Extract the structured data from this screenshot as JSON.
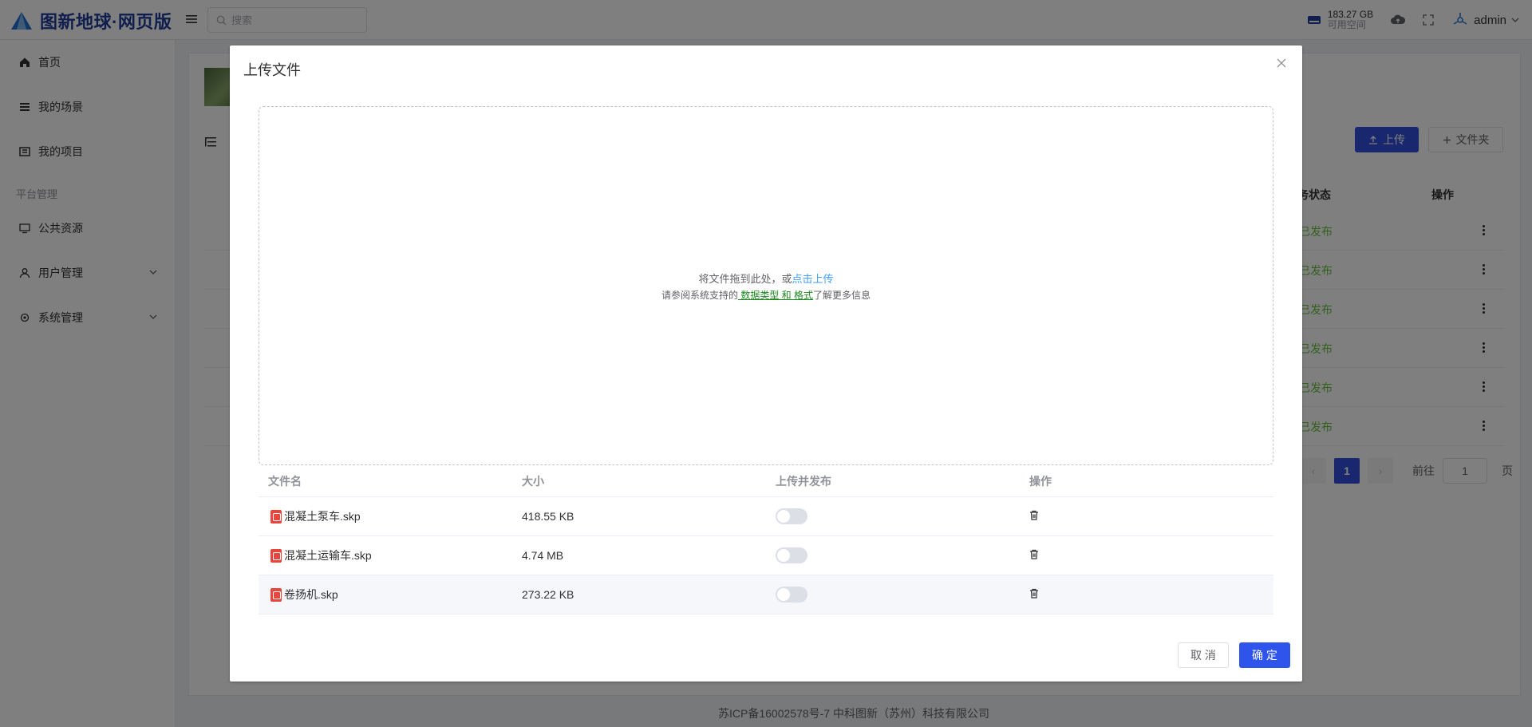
{
  "app": {
    "title": "图新地球·网页版",
    "search_placeholder": "搜索",
    "storage_size": "183.27 GB",
    "storage_label": "可用空间",
    "user": "admin",
    "accent": "#3350dd"
  },
  "sidebar": {
    "items": [
      {
        "label": "首页",
        "icon": "home-icon"
      },
      {
        "label": "我的场景",
        "icon": "list-icon"
      },
      {
        "label": "我的项目",
        "icon": "project-icon"
      }
    ],
    "group_label": "平台管理",
    "group_items": [
      {
        "label": "公共资源",
        "icon": "monitor-icon"
      },
      {
        "label": "用户管理",
        "icon": "user-icon"
      },
      {
        "label": "系统管理",
        "icon": "settings-icon"
      }
    ]
  },
  "main": {
    "upload_label": "上传",
    "folder_label": "文件夹",
    "col_status": "务状态",
    "col_actions": "操作",
    "rows_status": [
      "已发布",
      "已发布",
      "已发布",
      "已发布",
      "已发布",
      "已发布"
    ],
    "pager": {
      "current": "1",
      "goto_label": "前往",
      "goto_value": "1",
      "page_suffix": "页"
    }
  },
  "footer": "苏ICP备16002578号-7 中科图新（苏州）科技有限公司",
  "dialog": {
    "title": "上传文件",
    "drop_text": "将文件拖到此处，或",
    "drop_link": "点击上传",
    "hint_prefix": "请参阅系统支持的",
    "hint_link": " 数据类型 和 格式",
    "hint_suffix": "了解更多信息",
    "columns": [
      "文件名",
      "大小",
      "上传并发布",
      "操作"
    ],
    "files": [
      {
        "name": "混凝土泵车.skp",
        "size": "418.55 KB",
        "publish": false
      },
      {
        "name": "混凝土运输车.skp",
        "size": "4.74 MB",
        "publish": false
      },
      {
        "name": "卷扬机.skp",
        "size": "273.22 KB",
        "publish": false
      }
    ],
    "cancel_label": "取 消",
    "ok_label": "确 定"
  }
}
